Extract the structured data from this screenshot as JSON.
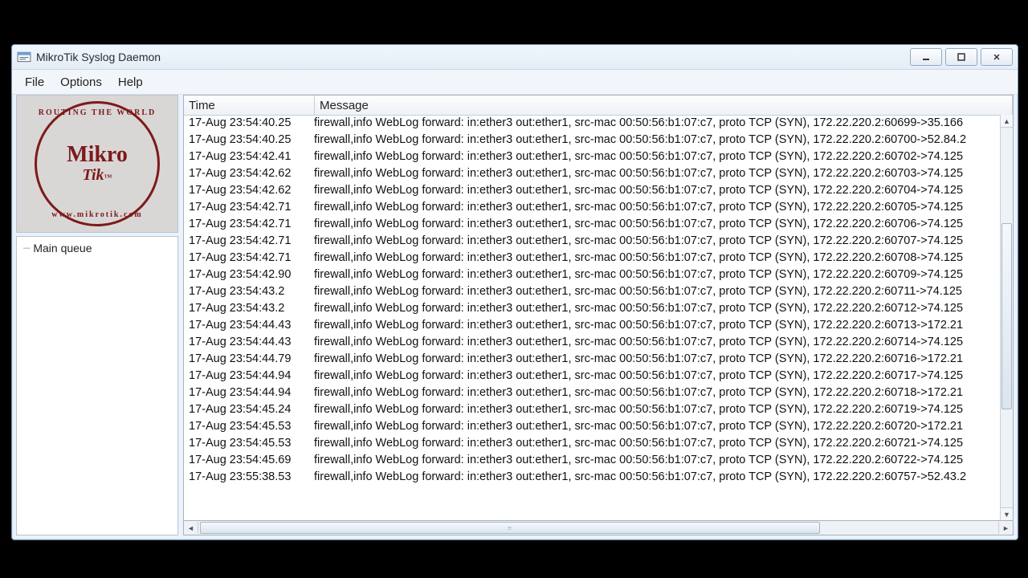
{
  "window": {
    "title": "MikroTik Syslog Daemon"
  },
  "menu": {
    "file": "File",
    "options": "Options",
    "help": "Help"
  },
  "logo": {
    "top_arc": "ROUTING THE WORLD",
    "line1": "Mikro",
    "line2": "Tik",
    "tm": "™",
    "bot_arc": "www.mikrotik.com"
  },
  "tree": {
    "item0": "Main queue"
  },
  "columns": {
    "time": "Time",
    "message": "Message"
  },
  "log": [
    {
      "time": "17-Aug 23:54:40.25",
      "msg": "firewall,info WebLog forward: in:ether3 out:ether1, src-mac 00:50:56:b1:07:c7, proto TCP (SYN), 172.22.220.2:60699->35.166"
    },
    {
      "time": "17-Aug 23:54:40.25",
      "msg": "firewall,info WebLog forward: in:ether3 out:ether1, src-mac 00:50:56:b1:07:c7, proto TCP (SYN), 172.22.220.2:60700->52.84.2"
    },
    {
      "time": "17-Aug 23:54:42.41",
      "msg": "firewall,info WebLog forward: in:ether3 out:ether1, src-mac 00:50:56:b1:07:c7, proto TCP (SYN), 172.22.220.2:60702->74.125"
    },
    {
      "time": "17-Aug 23:54:42.62",
      "msg": "firewall,info WebLog forward: in:ether3 out:ether1, src-mac 00:50:56:b1:07:c7, proto TCP (SYN), 172.22.220.2:60703->74.125"
    },
    {
      "time": "17-Aug 23:54:42.62",
      "msg": "firewall,info WebLog forward: in:ether3 out:ether1, src-mac 00:50:56:b1:07:c7, proto TCP (SYN), 172.22.220.2:60704->74.125"
    },
    {
      "time": "17-Aug 23:54:42.71",
      "msg": "firewall,info WebLog forward: in:ether3 out:ether1, src-mac 00:50:56:b1:07:c7, proto TCP (SYN), 172.22.220.2:60705->74.125"
    },
    {
      "time": "17-Aug 23:54:42.71",
      "msg": "firewall,info WebLog forward: in:ether3 out:ether1, src-mac 00:50:56:b1:07:c7, proto TCP (SYN), 172.22.220.2:60706->74.125"
    },
    {
      "time": "17-Aug 23:54:42.71",
      "msg": "firewall,info WebLog forward: in:ether3 out:ether1, src-mac 00:50:56:b1:07:c7, proto TCP (SYN), 172.22.220.2:60707->74.125"
    },
    {
      "time": "17-Aug 23:54:42.71",
      "msg": "firewall,info WebLog forward: in:ether3 out:ether1, src-mac 00:50:56:b1:07:c7, proto TCP (SYN), 172.22.220.2:60708->74.125"
    },
    {
      "time": "17-Aug 23:54:42.90",
      "msg": "firewall,info WebLog forward: in:ether3 out:ether1, src-mac 00:50:56:b1:07:c7, proto TCP (SYN), 172.22.220.2:60709->74.125"
    },
    {
      "time": "17-Aug 23:54:43.2",
      "msg": "firewall,info WebLog forward: in:ether3 out:ether1, src-mac 00:50:56:b1:07:c7, proto TCP (SYN), 172.22.220.2:60711->74.125"
    },
    {
      "time": "17-Aug 23:54:43.2",
      "msg": "firewall,info WebLog forward: in:ether3 out:ether1, src-mac 00:50:56:b1:07:c7, proto TCP (SYN), 172.22.220.2:60712->74.125"
    },
    {
      "time": "17-Aug 23:54:44.43",
      "msg": "firewall,info WebLog forward: in:ether3 out:ether1, src-mac 00:50:56:b1:07:c7, proto TCP (SYN), 172.22.220.2:60713->172.21"
    },
    {
      "time": "17-Aug 23:54:44.43",
      "msg": "firewall,info WebLog forward: in:ether3 out:ether1, src-mac 00:50:56:b1:07:c7, proto TCP (SYN), 172.22.220.2:60714->74.125"
    },
    {
      "time": "17-Aug 23:54:44.79",
      "msg": "firewall,info WebLog forward: in:ether3 out:ether1, src-mac 00:50:56:b1:07:c7, proto TCP (SYN), 172.22.220.2:60716->172.21"
    },
    {
      "time": "17-Aug 23:54:44.94",
      "msg": "firewall,info WebLog forward: in:ether3 out:ether1, src-mac 00:50:56:b1:07:c7, proto TCP (SYN), 172.22.220.2:60717->74.125"
    },
    {
      "time": "17-Aug 23:54:44.94",
      "msg": "firewall,info WebLog forward: in:ether3 out:ether1, src-mac 00:50:56:b1:07:c7, proto TCP (SYN), 172.22.220.2:60718->172.21"
    },
    {
      "time": "17-Aug 23:54:45.24",
      "msg": "firewall,info WebLog forward: in:ether3 out:ether1, src-mac 00:50:56:b1:07:c7, proto TCP (SYN), 172.22.220.2:60719->74.125"
    },
    {
      "time": "17-Aug 23:54:45.53",
      "msg": "firewall,info WebLog forward: in:ether3 out:ether1, src-mac 00:50:56:b1:07:c7, proto TCP (SYN), 172.22.220.2:60720->172.21"
    },
    {
      "time": "17-Aug 23:54:45.53",
      "msg": "firewall,info WebLog forward: in:ether3 out:ether1, src-mac 00:50:56:b1:07:c7, proto TCP (SYN), 172.22.220.2:60721->74.125"
    },
    {
      "time": "17-Aug 23:54:45.69",
      "msg": "firewall,info WebLog forward: in:ether3 out:ether1, src-mac 00:50:56:b1:07:c7, proto TCP (SYN), 172.22.220.2:60722->74.125"
    },
    {
      "time": "17-Aug 23:55:38.53",
      "msg": "firewall,info WebLog forward: in:ether3 out:ether1, src-mac 00:50:56:b1:07:c7, proto TCP (SYN), 172.22.220.2:60757->52.43.2"
    }
  ]
}
